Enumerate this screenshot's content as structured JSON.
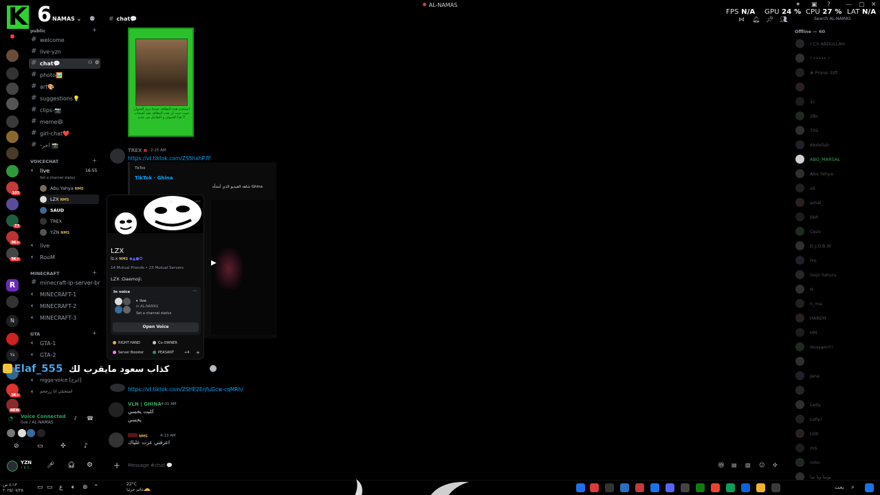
{
  "app": {
    "title": "AL-NAMAS",
    "logo_letter": "K",
    "logo_number": "6"
  },
  "perf": {
    "fps_label": "FPS",
    "fps_value": "N/A",
    "gpu_label": "GPU",
    "gpu_value": "24 %",
    "cpu_label": "CPU",
    "cpu_value": "27 %",
    "lat_label": "LAT",
    "lat_value": "N/A"
  },
  "server": {
    "name": "NAMAS",
    "search_placeholder": "Search AL-NAMAS"
  },
  "server_rail": {
    "badges": [
      "107",
      "77",
      "9K+",
      "9K+",
      "3K+",
      "NEW"
    ],
    "letters": [
      "R",
      "N",
      "Ys"
    ]
  },
  "channels": {
    "public_label": "public",
    "text": [
      {
        "label": "welcome"
      },
      {
        "label": "live-yzn"
      },
      {
        "label": "chat💬"
      },
      {
        "label": "photo🖼️"
      },
      {
        "label": "art🎨"
      },
      {
        "label": "suggestions💡"
      },
      {
        "label": "clips-📷"
      },
      {
        "label": "meme😆"
      },
      {
        "label": "girl-chat❤️"
      },
      {
        "label": "-اخر 📸"
      }
    ],
    "voicechat_label": "VOICECHAT",
    "voice_live": {
      "label": "live",
      "time": "16:55",
      "status": "Set a channel status"
    },
    "voice_users": [
      {
        "name": "Abu Yahya",
        "tag": "NMS"
      },
      {
        "name": "LZX",
        "tag": "NMS"
      },
      {
        "name": "SAUD",
        "tag": ""
      },
      {
        "name": "TREX",
        "tag": ""
      },
      {
        "name": "YZN",
        "tag": "NMS"
      }
    ],
    "voice_more": [
      {
        "label": "live"
      },
      {
        "label": "RooM"
      }
    ],
    "minecraft_label": "MINECRAFT",
    "minecraft": [
      {
        "label": "minecraft-ip-server-br"
      },
      {
        "label": "MINECRAFT-1"
      },
      {
        "label": "MINECRAFT-2"
      },
      {
        "label": "MINECRAFT-3"
      }
    ],
    "gta_label": "GTA",
    "gta": [
      {
        "label": "GTA-1"
      },
      {
        "label": "GTA-2"
      }
    ],
    "extra": [
      {
        "label": "nigga-voice [انزح]"
      },
      {
        "label": "استحيلي انا زرجحم"
      }
    ]
  },
  "voice_connected": {
    "title": "Voice Connected",
    "subtitle": "live / AL-NAMAS"
  },
  "user": {
    "name": "YZN",
    "status": "• K Y..."
  },
  "chat": {
    "channel": "chat💬",
    "card_text": "استخدم هذه البطاقة عندما ترى الحيوان حيث حيث أن هذه البطاقة تقيد أصحاب هذا الحيوان و التفاعل من جديد !!",
    "messages": [
      {
        "author": "TREX",
        "time": "2:25 AM",
        "link": "https://vt.tiktok.com/ZS5hxhP7F"
      },
      {
        "author": "VLN | GHINA",
        "time": "4:01 AM",
        "lines": [
          "كلبت يخسي",
          "يخسي"
        ]
      },
      {
        "author": "",
        "tag": "NMS",
        "time": "4:13 AM",
        "lines": [
          "اعرفتي عزت علياك"
        ]
      }
    ],
    "embed": {
      "provider": "TikTok",
      "title": "TikTok · Ghina",
      "desc": "شاهد الفيديو الذي أنشأه Ghina"
    },
    "link2": "https://vt.tiktok.com/ZSHE2ErjfuGcw-cqMRh/",
    "input_placeholder": "Message #chat 💬"
  },
  "profile": {
    "name": "LZX",
    "handle": "lz.x",
    "tag": "NMS",
    "mutual": "14 Mutual Friends • 23 Mutual Servers",
    "status": "LZX :Daemoji:",
    "in_voice_label": "In voice",
    "voice_channel": "live",
    "voice_server": "in AL-NAMAS",
    "voice_status": "Set a channel status",
    "open_voice": "Open Voice",
    "roles": [
      {
        "name": "RIGHT HAND",
        "color": "#f0b132"
      },
      {
        "name": "Co-OWNER",
        "color": "#c6c6c6"
      },
      {
        "name": "Server Booster",
        "color": "#f47fff"
      },
      {
        "name": "PEASANT",
        "color": "#3b8f5c"
      }
    ],
    "more_roles": "+4"
  },
  "overlay": {
    "name": "Elaf_555",
    "caption": "كذاب سعود مايقرب لك"
  },
  "members": {
    "header": "Offline — 60",
    "list": [
      {
        "name": "! CS ABDULLAH"
      },
      {
        "name": "! ••••• !"
      },
      {
        "name": "# Prime 3zff"
      },
      {
        "name": ""
      },
      {
        "name": "1c"
      },
      {
        "name": "2Bc"
      },
      {
        "name": "702"
      },
      {
        "name": "Abdellah"
      },
      {
        "name": "ABO_MARSAL",
        "highlight": true
      },
      {
        "name": "Abu Yahya"
      },
      {
        "name": "ali"
      },
      {
        "name": "amal_"
      },
      {
        "name": "bbh"
      },
      {
        "name": "Cezo"
      },
      {
        "name": "D.J.O.B.W"
      },
      {
        "name": "Fro"
      },
      {
        "name": "Gojo Saturu"
      },
      {
        "name": "H"
      },
      {
        "name": "h_ma"
      },
      {
        "name": "HAREM"
      },
      {
        "name": "HM"
      },
      {
        "name": "Hossam!!!"
      },
      {
        "name": ""
      },
      {
        "name": "Jana"
      },
      {
        "name": ""
      },
      {
        "name": "Lady"
      },
      {
        "name": "Lolly!"
      },
      {
        "name": "LOX"
      },
      {
        "name": "mS"
      },
      {
        "name": "mhn"
      },
      {
        "name": "ﺑﻮﺳﺎ ﻭﻳﺎ ﺳﺎ"
      }
    ]
  },
  "taskbar": {
    "clock_time": "٤:١٣ ص",
    "clock_date": "٢٠٢٥/٠٧/٢٥",
    "weather_temp": "22°C",
    "weather_desc": "غائم جزئيا",
    "search_label": "بحث"
  },
  "colors": {
    "accent_green": "#2ed22e",
    "voice_green": "#23a55a",
    "link_blue": "#00a8fc",
    "mention_red": "#f23f43"
  }
}
